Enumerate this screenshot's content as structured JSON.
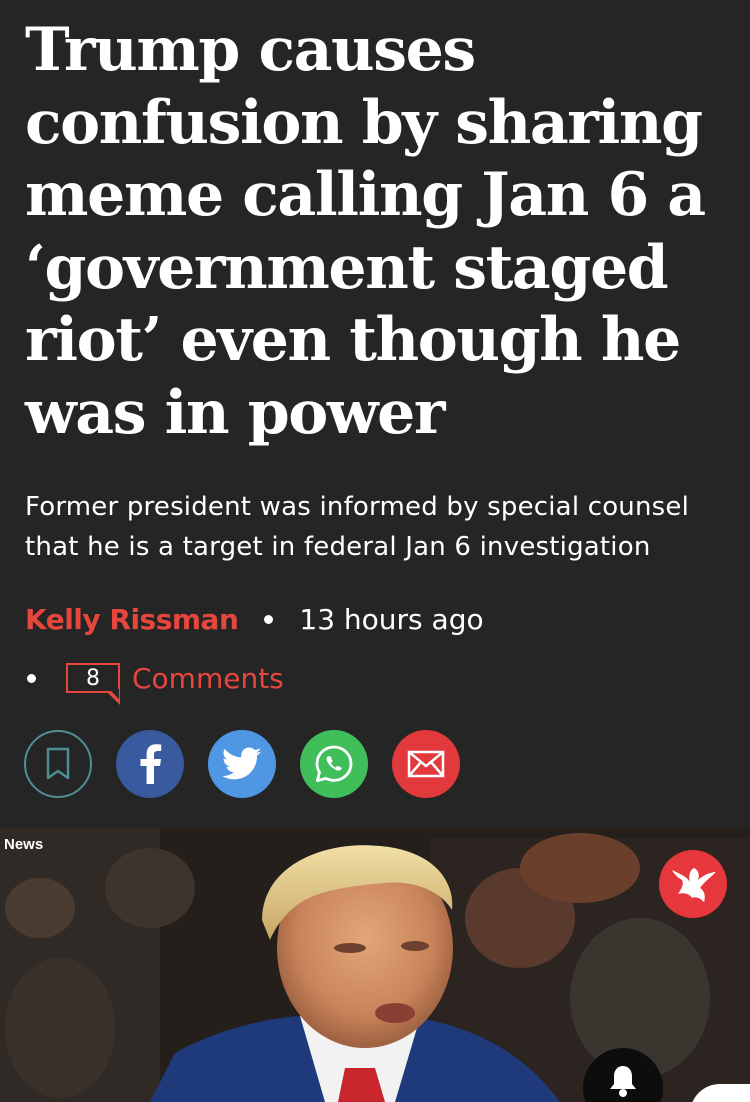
{
  "article": {
    "headline": "Trump causes confusion by sharing meme calling Jan 6 a ‘government staged riot’ even though he was in power",
    "standfirst": "Former president was informed by special counsel that he is a target in federal Jan 6 investigation",
    "author": "Kelly Rissman",
    "time_ago": "13 hours ago",
    "comment_count": "8",
    "comments_label": "Comments"
  },
  "share": {
    "buttons": [
      "bookmark-icon",
      "facebook-icon",
      "twitter-icon",
      "whatsapp-icon",
      "email-icon"
    ]
  },
  "video": {
    "label": "News",
    "logo": "eagle-logo",
    "notification_icon": "bell-icon"
  },
  "colors": {
    "background": "#252526",
    "accent_red": "#e5473c",
    "bookmark_teal": "#4e8f92",
    "facebook": "#3a5aa0",
    "twitter": "#4f96e3",
    "whatsapp": "#3fbe5a",
    "email": "#e1393c"
  }
}
